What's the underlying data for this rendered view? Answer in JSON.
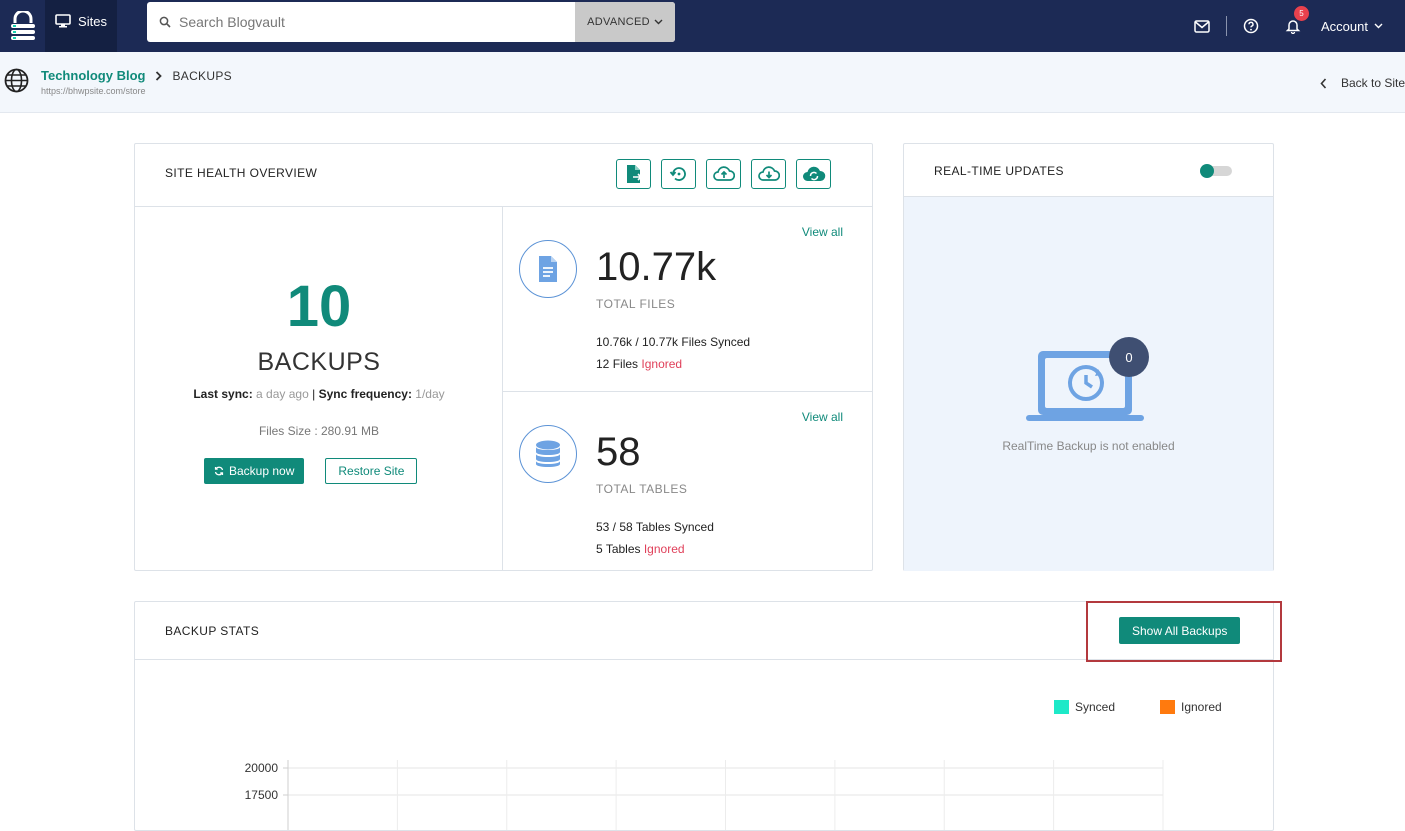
{
  "nav": {
    "sites_label": "Sites",
    "search_placeholder": "Search Blogvault",
    "advanced_label": "ADVANCED",
    "notification_count": "5",
    "account_label": "Account"
  },
  "breadcrumb": {
    "site_name": "Technology Blog",
    "current": "BACKUPS",
    "site_url": "https://bhwpsite.com/store",
    "back_label": "Back to Site"
  },
  "health": {
    "title": "SITE HEALTH OVERVIEW",
    "backups_count": "10",
    "backups_label": "BACKUPS",
    "last_sync_label": "Last sync:",
    "last_sync_value": "a day ago",
    "sep": "|",
    "sync_freq_label": "Sync frequency:",
    "sync_freq_value": "1/day",
    "files_size": "Files Size : 280.91 MB",
    "backup_now_label": "Backup now",
    "restore_label": "Restore Site",
    "files": {
      "view_all": "View all",
      "value": "10.77k",
      "label": "TOTAL FILES",
      "synced": "10.76k / 10.77k",
      "synced_suffix": "Files Synced",
      "ignored_count": "12",
      "ignored_prefix": "Files",
      "ignored_label": "Ignored"
    },
    "tables": {
      "view_all": "View all",
      "value": "58",
      "label": "TOTAL TABLES",
      "synced": "53 / 58",
      "synced_suffix": "Tables Synced",
      "ignored_count": "5",
      "ignored_prefix": "Tables",
      "ignored_label": "Ignored"
    }
  },
  "realtime": {
    "title": "REAL-TIME UPDATES",
    "enabled": false,
    "count": "0",
    "status_text": "RealTime Backup is not enabled"
  },
  "stats": {
    "title": "BACKUP STATS",
    "show_all_label": "Show All Backups"
  },
  "chart_data": {
    "type": "bar",
    "series": [
      {
        "name": "Synced",
        "color": "#1de9c8",
        "values": []
      },
      {
        "name": "Ignored",
        "color": "#ff7a0e",
        "values": []
      }
    ],
    "y_ticks": [
      20000,
      17500
    ],
    "legend": "top-right",
    "grid": true
  },
  "colors": {
    "nav_bg": "#1c2a55",
    "accent": "#108a7a",
    "ignored": "#e0405a",
    "highlight_border": "#b3393e"
  }
}
